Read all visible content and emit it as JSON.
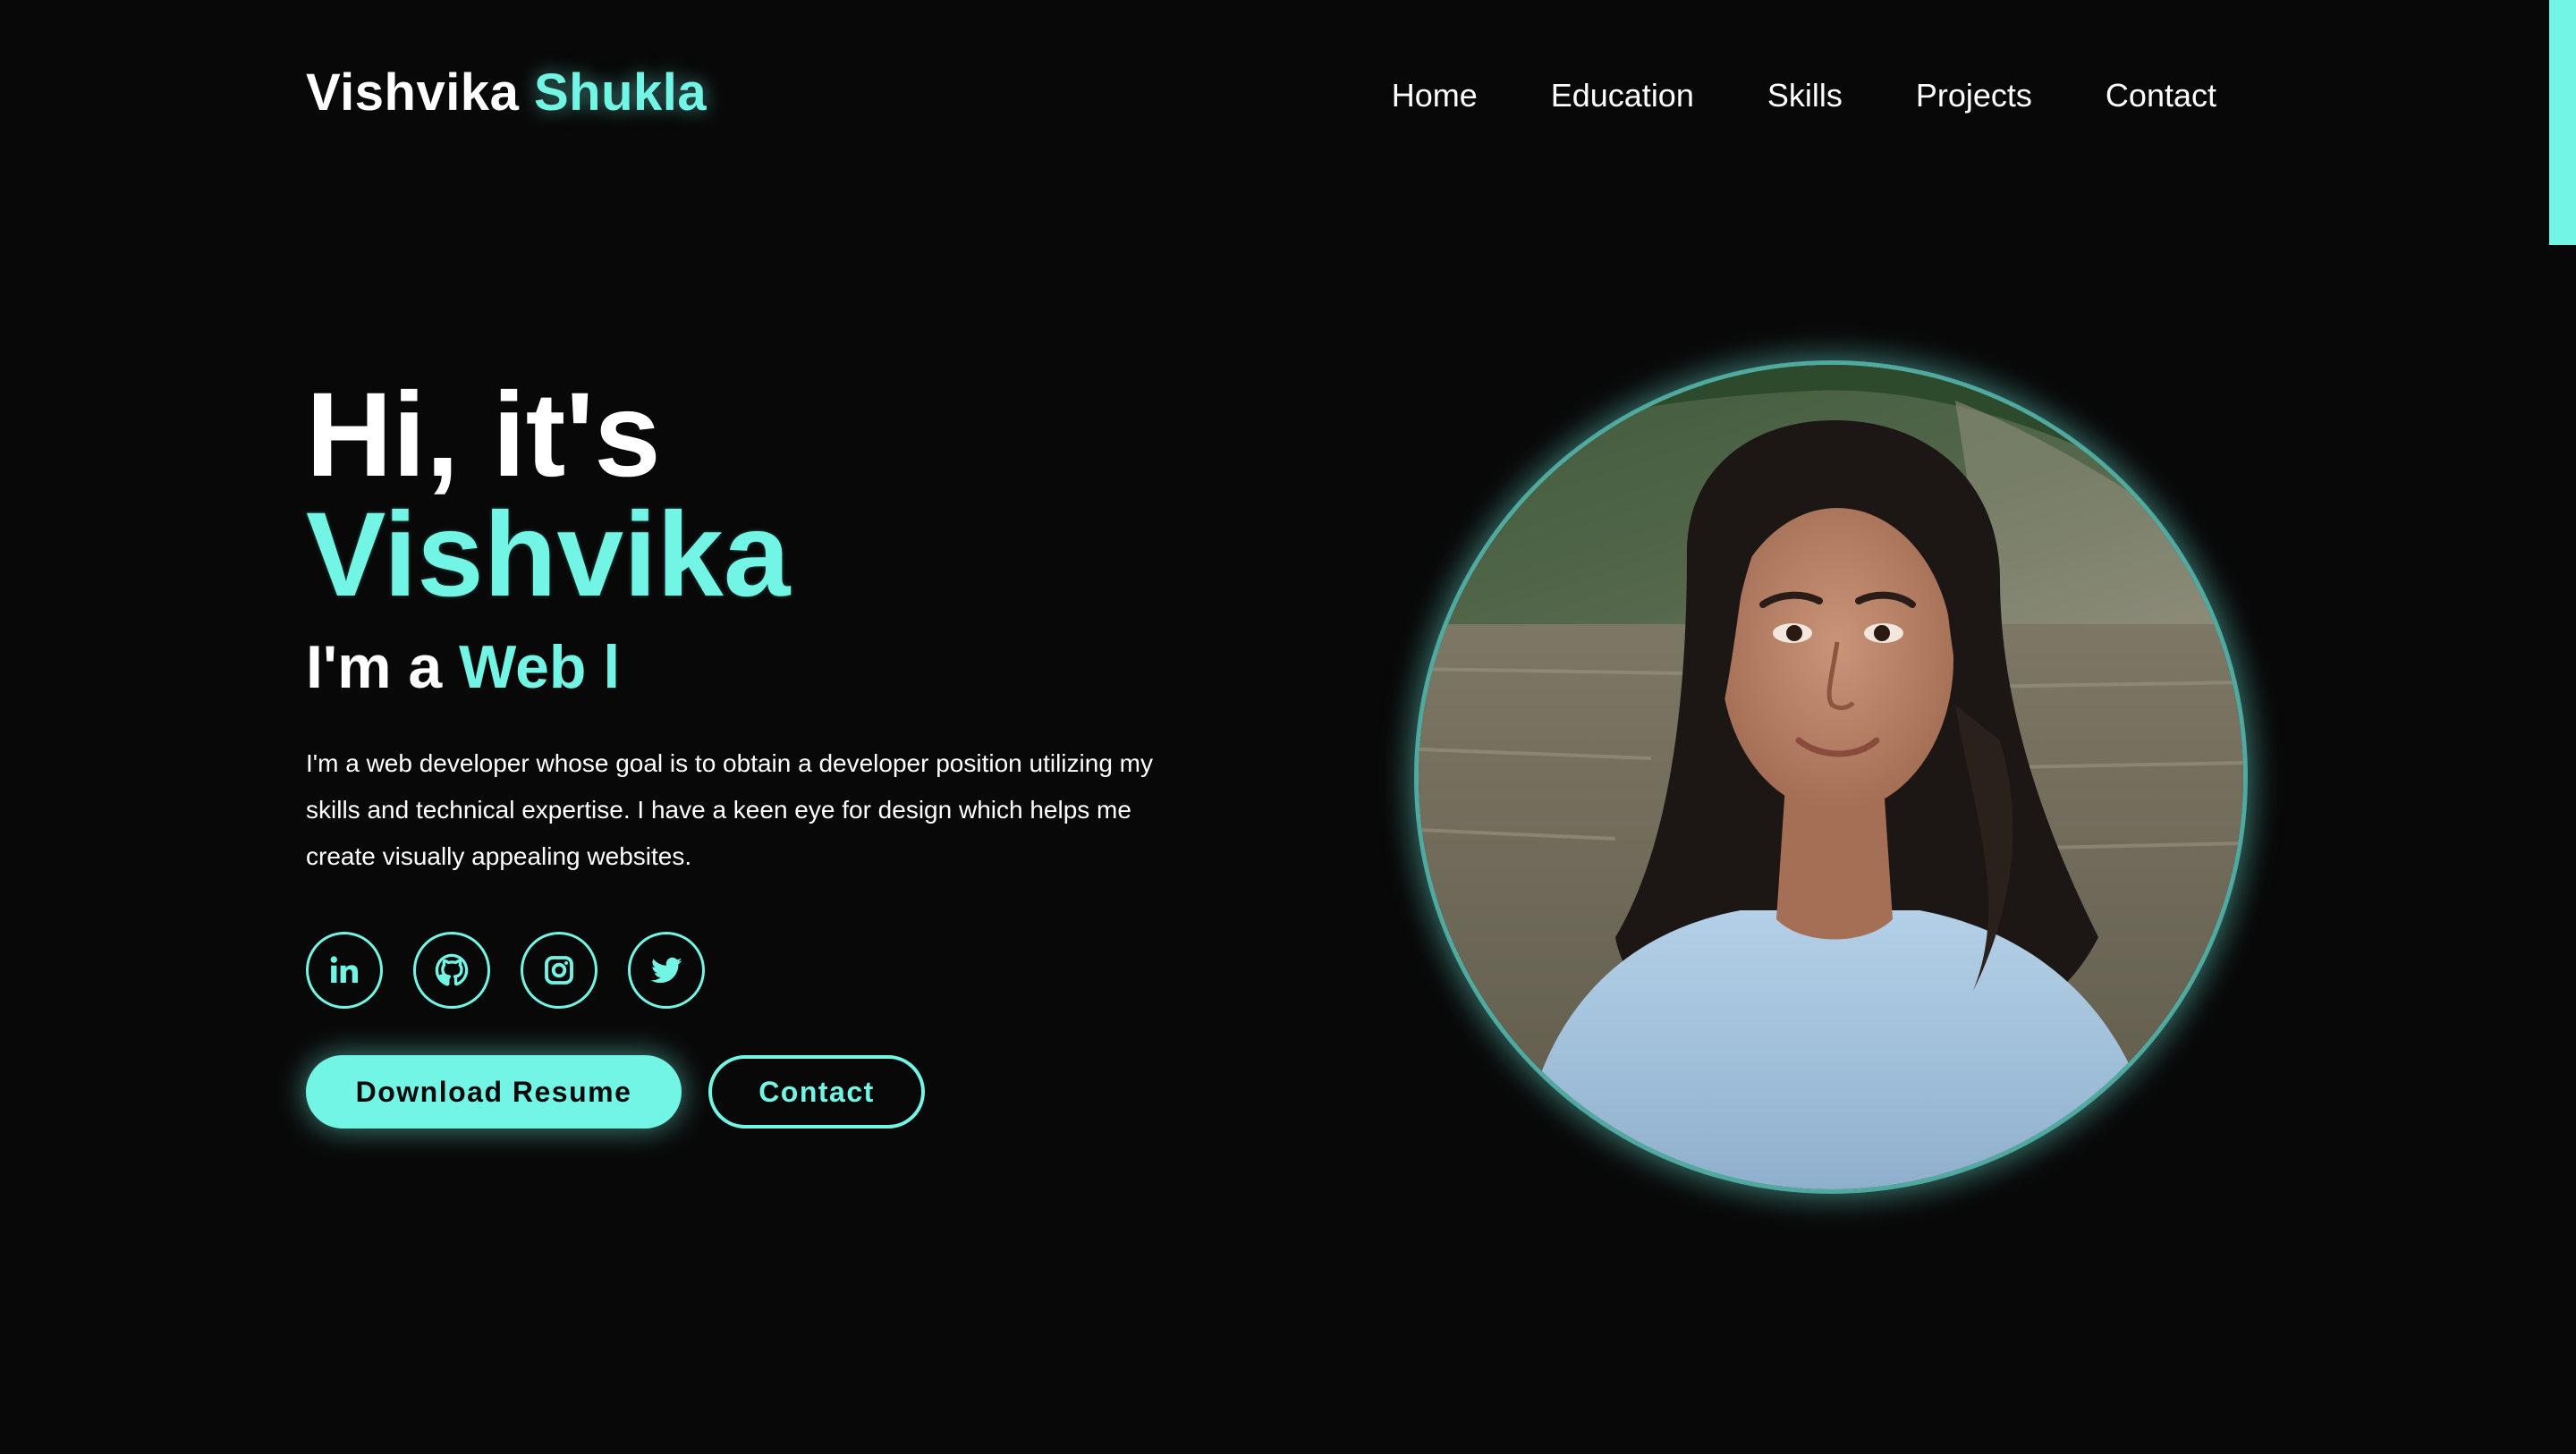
{
  "header": {
    "logo_first": "Vishvika",
    "logo_last": "Shukla",
    "nav": [
      "Home",
      "Education",
      "Skills",
      "Projects",
      "Contact"
    ]
  },
  "hero": {
    "greeting": "Hi, it's",
    "name": "Vishvika",
    "role_prefix": "I'm a",
    "role_typed": "Web l",
    "description": "I'm a web developer whose goal is to obtain a developer position utilizing my skills and technical expertise. I have a keen eye for design which helps me create visually appealing websites.",
    "socials": [
      "linkedin-icon",
      "github-icon",
      "instagram-icon",
      "twitter-icon"
    ],
    "primary_button": "Download Resume",
    "secondary_button": "Contact"
  },
  "colors": {
    "accent": "#73f5e6",
    "background": "#080808",
    "text": "#ffffff"
  }
}
